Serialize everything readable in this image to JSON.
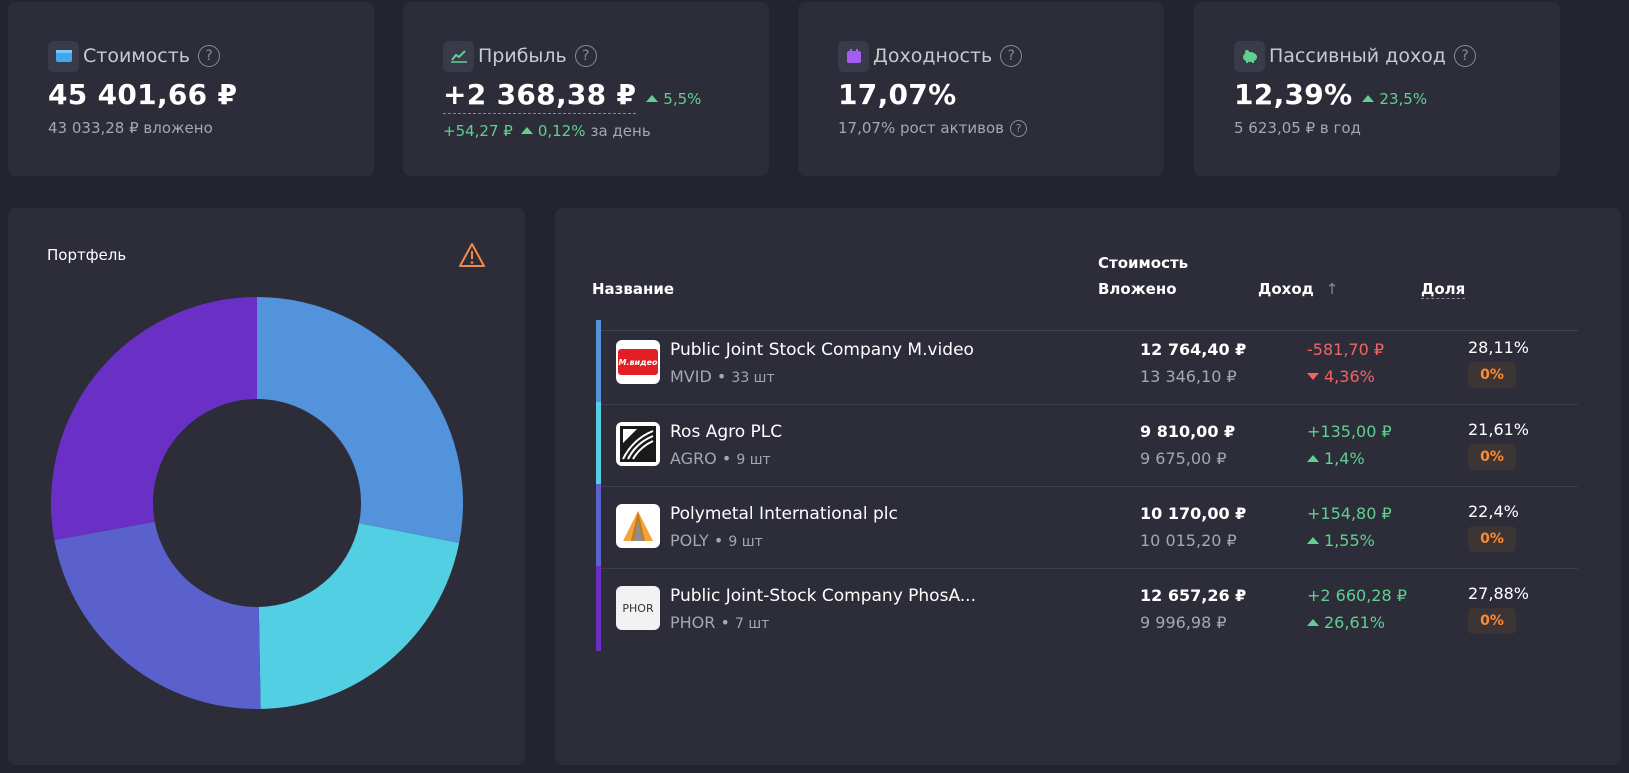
{
  "stats": [
    {
      "label": "Стоимость",
      "icon": "wallet-icon",
      "value": "45 401,66 ₽",
      "sub": "43 033,28 ₽ вложено"
    },
    {
      "label": "Прибыль",
      "icon": "chart-icon",
      "value": "+2 368,38 ₽",
      "delta": "5,5%",
      "day_value": "+54,27 ₽",
      "day_pct": "0,12%",
      "day_label": "за день"
    },
    {
      "label": "Доходность",
      "icon": "calendar-icon",
      "value": "17,07%",
      "sub": "17,07% рост активов"
    },
    {
      "label": "Пассивный доход",
      "icon": "piggy-bank-icon",
      "value": "12,39%",
      "delta": "23,5%",
      "sub": "5 623,05 ₽ в год"
    }
  ],
  "portfolio": {
    "title": "Портфель",
    "slices": [
      {
        "ticker": "MVID",
        "share": 28.11,
        "color": "#5393db"
      },
      {
        "ticker": "AGRO",
        "share": 21.61,
        "color": "#52cfe3"
      },
      {
        "ticker": "POLY",
        "share": 22.4,
        "color": "#5a60cc"
      },
      {
        "ticker": "PHOR",
        "share": 27.88,
        "color": "#6a30c5"
      }
    ]
  },
  "table": {
    "headers": {
      "name": "Название",
      "value": "Стоимость",
      "invested": "Вложено",
      "income": "Доход",
      "share": "Доля"
    },
    "rows": [
      {
        "name": "Public Joint Stock Company M.video",
        "ticker": "MVID",
        "qty": "33 шт",
        "value": "12 764,40 ₽",
        "invested": "13 346,10 ₽",
        "pl": "-581,70 ₽",
        "pl_pct": "4,36%",
        "direction": "down",
        "share": "28,11%",
        "badge": "0%",
        "color": "#5393db",
        "logo_text": "М.видео"
      },
      {
        "name": "Ros Agro PLC",
        "ticker": "AGRO",
        "qty": "9 шт",
        "value": "9 810,00 ₽",
        "invested": "9 675,00 ₽",
        "pl": "+135,00 ₽",
        "pl_pct": "1,4%",
        "direction": "up",
        "share": "21,61%",
        "badge": "0%",
        "color": "#52cfe3",
        "logo_text": ""
      },
      {
        "name": "Polymetal International plc",
        "ticker": "POLY",
        "qty": "9 шт",
        "value": "10 170,00 ₽",
        "invested": "10 015,20 ₽",
        "pl": "+154,80 ₽",
        "pl_pct": "1,55%",
        "direction": "up",
        "share": "22,4%",
        "badge": "0%",
        "color": "#5a60cc",
        "logo_text": ""
      },
      {
        "name": "Public Joint-Stock Company PhosA...",
        "ticker": "PHOR",
        "qty": "7 шт",
        "value": "12 657,26 ₽",
        "invested": "9 996,98 ₽",
        "pl": "+2 660,28 ₽",
        "pl_pct": "26,61%",
        "direction": "up",
        "share": "27,88%",
        "badge": "0%",
        "color": "#6a30c5",
        "logo_text": "PHOR"
      }
    ]
  }
}
